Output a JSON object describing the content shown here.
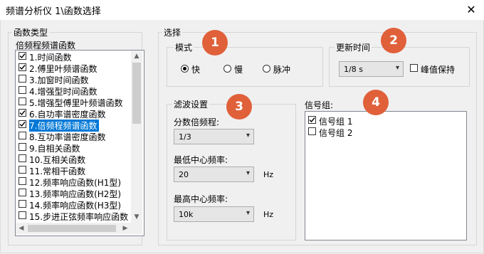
{
  "window": {
    "title": "频谱分析仪 1\\函数选择",
    "close_glyph": "✕"
  },
  "function_type": {
    "group_label": "函数类型",
    "list_label": "倍频程频谱函数",
    "items": [
      {
        "label": "1.时间函数",
        "checked": true,
        "selected": false
      },
      {
        "label": "2.傅里叶频谱函数",
        "checked": true,
        "selected": false
      },
      {
        "label": "3.加窗时间函数",
        "checked": false,
        "selected": false
      },
      {
        "label": "4.增强型时间函数",
        "checked": false,
        "selected": false
      },
      {
        "label": "5.增强型傅里叶频谱函数",
        "checked": false,
        "selected": false
      },
      {
        "label": "6.自功率谱密度函数",
        "checked": true,
        "selected": false
      },
      {
        "label": "7.倍频程频谱函数",
        "checked": true,
        "selected": true
      },
      {
        "label": "8.互功率谱密度函数",
        "checked": false,
        "selected": false
      },
      {
        "label": "9.自相关函数",
        "checked": false,
        "selected": false
      },
      {
        "label": "10.互相关函数",
        "checked": false,
        "selected": false
      },
      {
        "label": "11.常相干函数",
        "checked": false,
        "selected": false
      },
      {
        "label": "12.频率响应函数(H1型)",
        "checked": false,
        "selected": false
      },
      {
        "label": "13.频率响应函数(H2型)",
        "checked": false,
        "selected": false
      },
      {
        "label": "14.频率响应函数(H3型)",
        "checked": false,
        "selected": false
      },
      {
        "label": "15.步进正弦频率响应函数",
        "checked": false,
        "selected": false
      }
    ],
    "scroll_up": "▲",
    "scroll_down": "▼",
    "scroll_left": "◀",
    "scroll_right": "▶"
  },
  "select_group": {
    "label": "选择"
  },
  "mode": {
    "label": "模式",
    "options": [
      {
        "label": "快",
        "selected": true
      },
      {
        "label": "慢",
        "selected": false
      },
      {
        "label": "脉冲",
        "selected": false
      }
    ]
  },
  "update_time": {
    "label": "更新时间",
    "value": "1/8 s",
    "peak_hold_label": "峰值保持",
    "peak_hold_checked": false
  },
  "filter": {
    "label": "滤波设置",
    "octave_label": "分数倍频程:",
    "octave_value": "1/3",
    "min_label": "最低中心频率:",
    "min_value": "20",
    "min_unit": "Hz",
    "max_label": "最高中心频率:",
    "max_value": "10k",
    "max_unit": "Hz"
  },
  "signal_group": {
    "label": "信号组:",
    "items": [
      {
        "label": "信号组 1",
        "checked": true
      },
      {
        "label": "信号组 2",
        "checked": false
      }
    ]
  },
  "badges": [
    "1",
    "2",
    "3",
    "4"
  ],
  "colors": {
    "badge": "#e0603a",
    "selection": "#0078d7"
  }
}
